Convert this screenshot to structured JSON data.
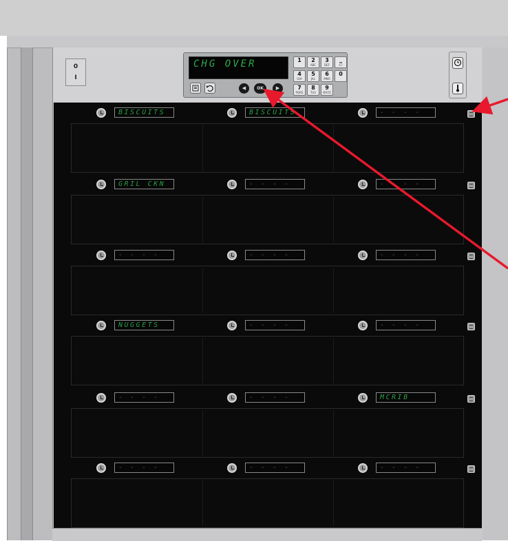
{
  "power_switch": {
    "off_label": "0",
    "on_label": "I"
  },
  "display": {
    "text": "CHG OVER"
  },
  "keypad": [
    {
      "digit": "1",
      "letters": ""
    },
    {
      "digit": "2",
      "letters": "ABC"
    },
    {
      "digit": "3",
      "letters": "DEF"
    },
    {
      "digit": "⎵",
      "letters": "+/-"
    },
    {
      "digit": "4",
      "letters": "GHI"
    },
    {
      "digit": "5",
      "letters": "JKL"
    },
    {
      "digit": "6",
      "letters": "MNO"
    },
    {
      "digit": "0",
      "letters": ""
    },
    {
      "digit": "7",
      "letters": "PQRS"
    },
    {
      "digit": "8",
      "letters": "TUV"
    },
    {
      "digit": "9",
      "letters": "WXYZ"
    }
  ],
  "nav": {
    "menu_icon": "menu-icon",
    "back_icon": "undo-arrow-icon",
    "left_icon": "◀",
    "ok_label": "OK",
    "right_icon": "▶"
  },
  "side_buttons": {
    "timer_icon": "clock-icon",
    "temp_icon": "thermometer-icon"
  },
  "shelves": [
    {
      "slots": [
        "BISCUITS",
        "BISCUITS",
        "- - - -"
      ]
    },
    {
      "slots": [
        "GRIL CKN",
        "- - - -",
        "- - - -"
      ]
    },
    {
      "slots": [
        "- - - -",
        "- - - -",
        "- - - -"
      ]
    },
    {
      "slots": [
        "NUGGETS",
        "- - - -",
        "- - - -"
      ]
    },
    {
      "slots": [
        "- - - -",
        "- - - -",
        "MCRIB"
      ]
    },
    {
      "slots": [
        "- - - -",
        "- - - -",
        "- - - -"
      ]
    }
  ],
  "annotation": {
    "arrow_color": "#e8192c"
  }
}
